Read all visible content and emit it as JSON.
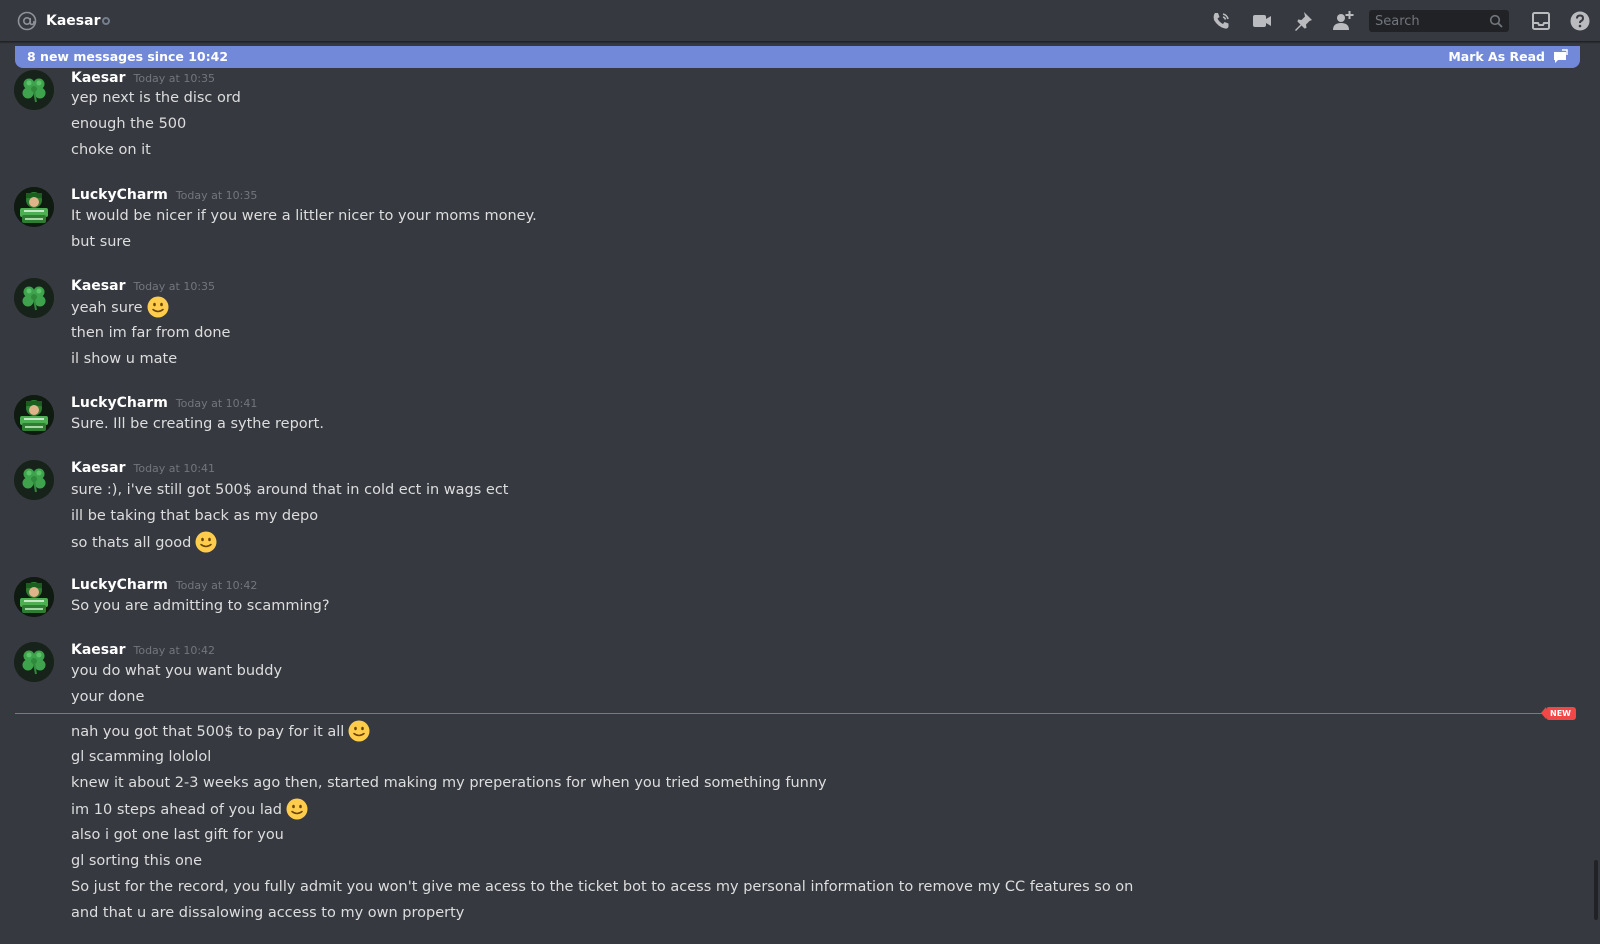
{
  "header": {
    "channel_name": "Kaesar",
    "search_placeholder": "Search"
  },
  "new_bar": {
    "text": "8 new messages since 10:42",
    "mark_read": "Mark As Read"
  },
  "new_badge": "NEW",
  "groups": [
    {
      "author": "Kaesar",
      "timestamp": "Today at 10:35",
      "lines": [
        "yep next is the disc ord",
        "enough the 500",
        "choke on it"
      ]
    },
    {
      "author": "LuckyCharm",
      "timestamp": "Today at 10:35",
      "lines": [
        "It would be nicer if you were a littler nicer to your moms money.",
        "but sure"
      ]
    },
    {
      "author": "Kaesar",
      "timestamp": "Today at 10:35",
      "lines": [
        "yeah sure",
        "then im far from done",
        "il show u mate"
      ]
    },
    {
      "author": "LuckyCharm",
      "timestamp": "Today at 10:41",
      "lines": [
        "Sure. Ill be creating a sythe report."
      ]
    },
    {
      "author": "Kaesar",
      "timestamp": "Today at 10:41",
      "lines": [
        "sure :), i've still got 500$ around that in cold ect in wags ect",
        "ill be taking that back as my depo",
        "so thats all good"
      ]
    },
    {
      "author": "LuckyCharm",
      "timestamp": "Today at 10:42",
      "lines": [
        "So you are admitting to scamming?"
      ]
    },
    {
      "author": "Kaesar",
      "timestamp": "Today at 10:42",
      "lines": [
        "you do what you want buddy",
        "your done"
      ]
    }
  ],
  "new_lines": [
    "nah you got that 500$ to pay for it all",
    "gl scamming lololol",
    "knew it about 2-3 weeks ago then, started making my preperations for when you tried something funny",
    "im 10 steps ahead of you lad",
    "also i got one last gift for you",
    "gl sorting this one",
    "So just for the record, you fully admit you won't give me acess to the ticket bot to acess my personal information to remove my CC features so on",
    "and that u are dissalowing access to my own property"
  ],
  "colors": {
    "background": "#36393f",
    "blurple": "#7289da",
    "new_red": "#f04747",
    "text": "#dcddde",
    "timestamp": "#72767d"
  },
  "icons": [
    "at-icon",
    "status-icon",
    "call-icon",
    "video-icon",
    "pin-icon",
    "add-member-icon",
    "search-icon",
    "inbox-icon",
    "help-icon",
    "mark-read-icon",
    "emoji-slight-smile"
  ]
}
